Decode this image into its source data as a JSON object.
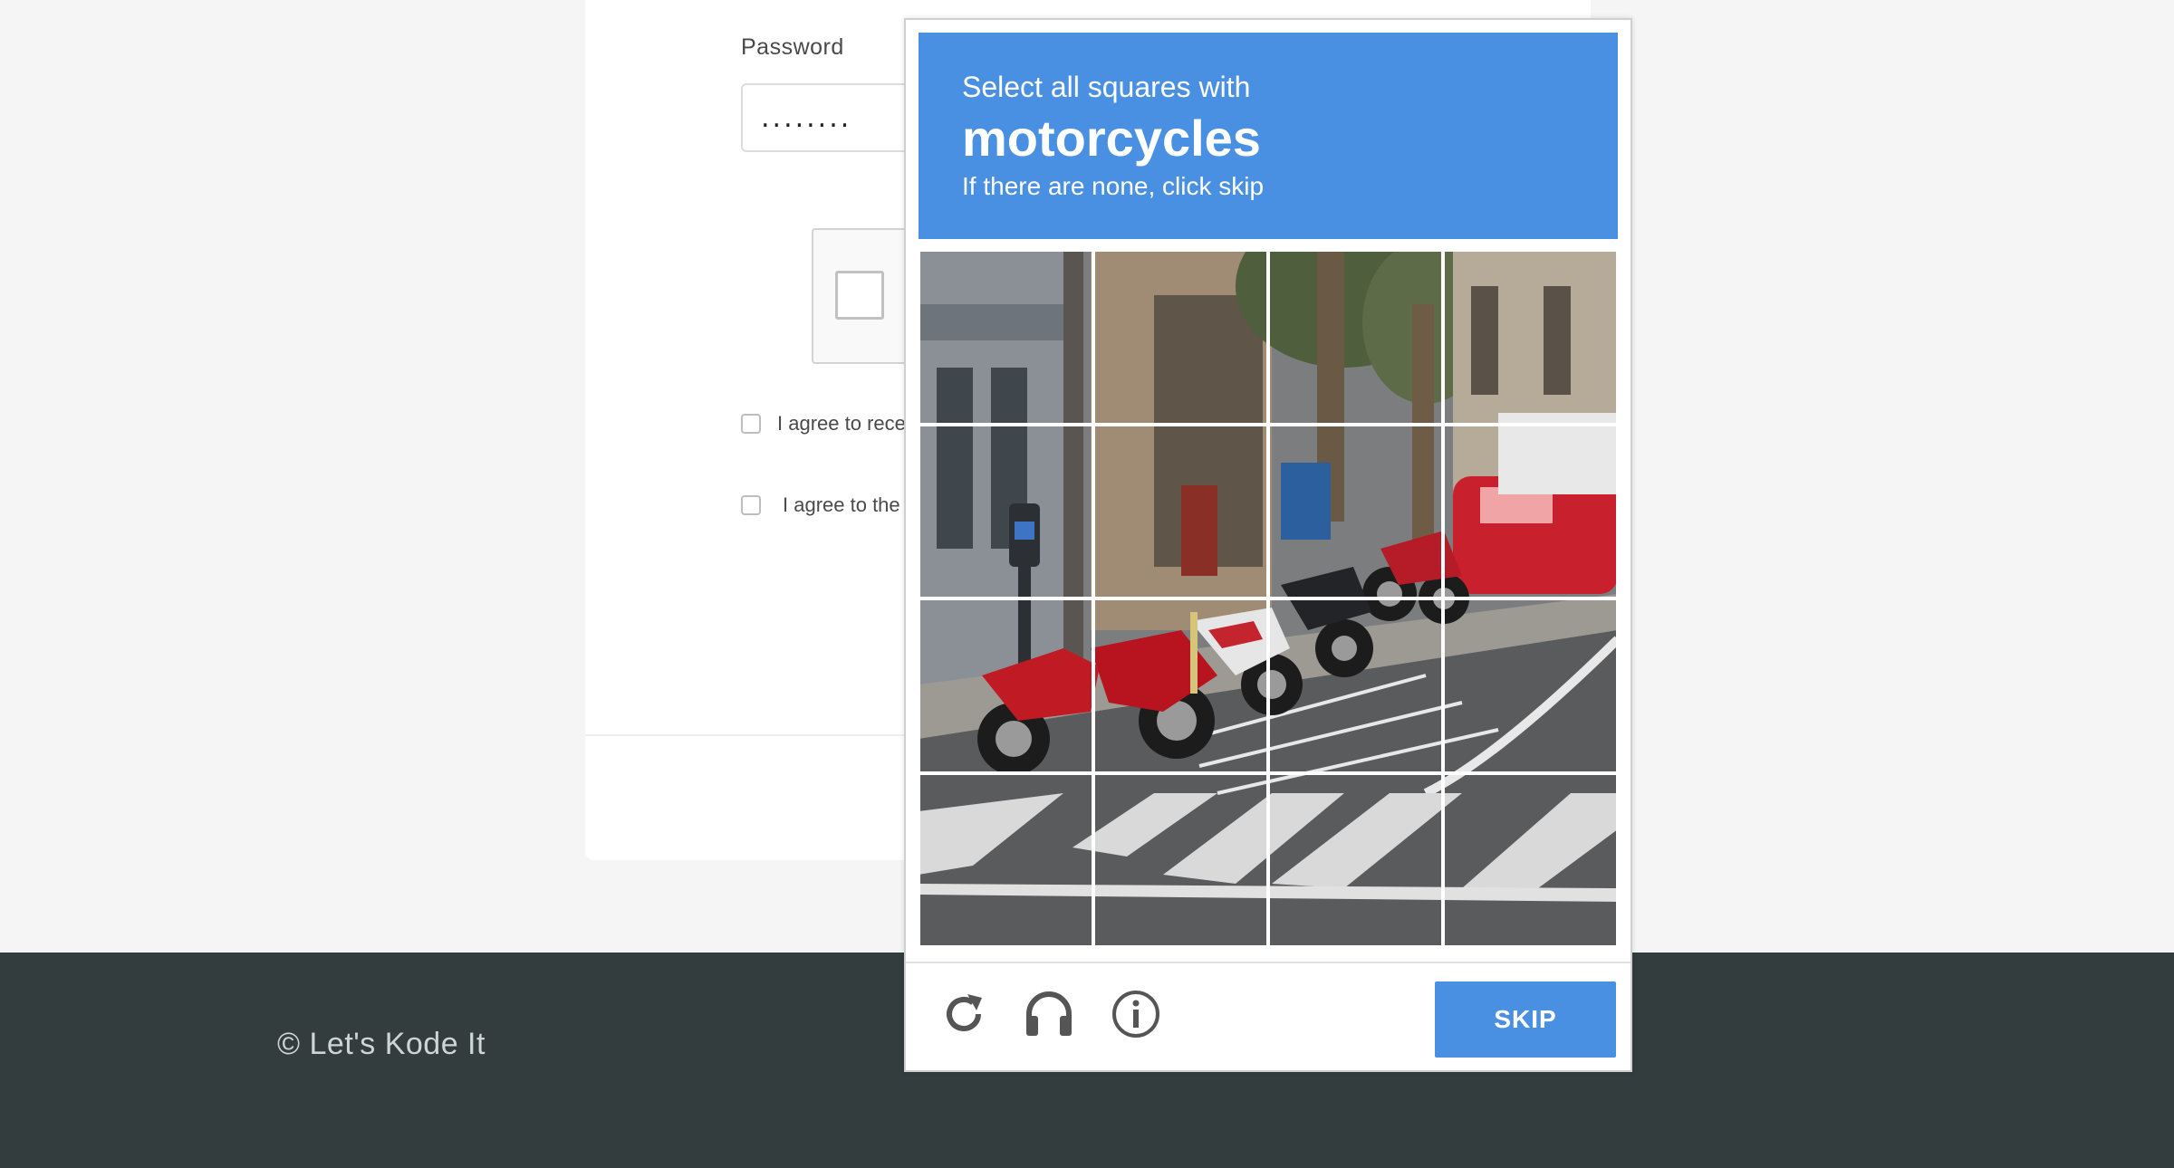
{
  "signup_form": {
    "password_label": "Password",
    "password_value": "........",
    "agree_receive_text": "I agree to rece",
    "agree_terms_text": "I agree to the"
  },
  "footer": {
    "copyright": "© Let's Kode It"
  },
  "captcha": {
    "instruction": "Select all squares with",
    "object": "motorcycles",
    "subtext": "If there are none, click skip",
    "skip_label": "SKIP",
    "grid": {
      "rows": 4,
      "columns": 4
    },
    "icons": [
      "reload-icon",
      "headphones-icon",
      "info-icon"
    ],
    "colors": {
      "header": "#4a90e2",
      "skip_button": "#4a90e2",
      "footer_bar": "#333d3e"
    }
  }
}
